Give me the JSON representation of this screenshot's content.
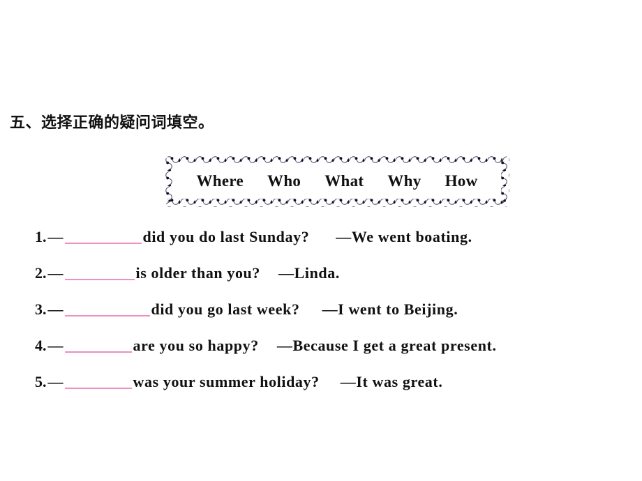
{
  "section": {
    "heading": "五、选择正确的疑问词填空。"
  },
  "word_bank": {
    "border_style": "dotted-scallop",
    "border_color": "#3a3a66",
    "words": [
      {
        "label": "Where"
      },
      {
        "label": "Who"
      },
      {
        "label": "What"
      },
      {
        "label": "Why"
      },
      {
        "label": "How"
      }
    ]
  },
  "blank_color": "#eb8fc4",
  "questions": [
    {
      "number": "1.",
      "dash": "—",
      "blank_value": "",
      "prompt": "did you do last Sunday?",
      "answer": "—We went boating."
    },
    {
      "number": "2.",
      "dash": "—",
      "blank_value": "",
      "prompt": "is older than you?",
      "answer": "—Linda."
    },
    {
      "number": "3.",
      "dash": "—",
      "blank_value": "",
      "prompt": "did you go last week?",
      "answer": "—I went to Beijing."
    },
    {
      "number": "4.",
      "dash": "—",
      "blank_value": "",
      "prompt": "are you so happy?",
      "answer": "—Because I get a great present."
    },
    {
      "number": "5.",
      "dash": "—",
      "blank_value": "",
      "prompt": "was your summer holiday?",
      "answer": "—It was great."
    }
  ]
}
